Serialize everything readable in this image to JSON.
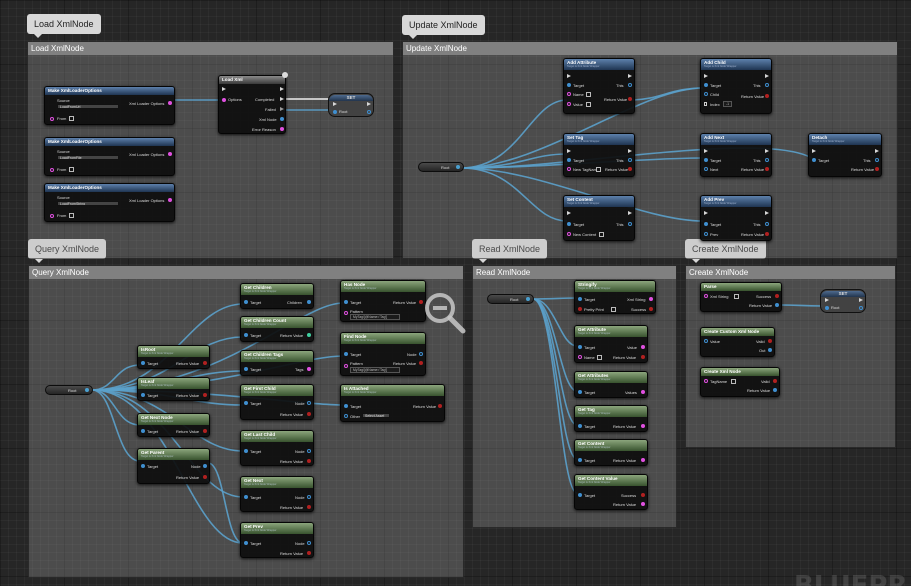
{
  "comments": [
    {
      "title": "Load XmlNode",
      "bubble": "Load XmlNode"
    },
    {
      "title": "Update XmlNode",
      "bubble": "Update XmlNode"
    },
    {
      "title": "Query XmlNode",
      "bubble": "Query XmlNode"
    },
    {
      "title": "Read XmlNode",
      "bubble": "Read XmlNode"
    },
    {
      "title": "Create XmlNode",
      "bubble": "Create XmlNode"
    }
  ],
  "nodes": {
    "make_opts_1": {
      "title": "Make XmlLoaderOptions",
      "source": "Source",
      "source_val": "LoadFromUrl",
      "out": "Xml Loader Options",
      "from": "From"
    },
    "make_opts_2": {
      "title": "Make XmlLoaderOptions",
      "source": "Source",
      "source_val": "LoadFromFile",
      "out": "Xml Loader Options",
      "from": "From"
    },
    "make_opts_3": {
      "title": "Make XmlLoaderOptions",
      "source": "Source",
      "source_val": "LoadFromString",
      "out": "Xml Loader Options",
      "from": "From"
    },
    "load_xml": {
      "title": "Load Xml",
      "options": "Options",
      "completed": "Completed",
      "failed": "Failed",
      "xml_node": "Xml Node",
      "error": "Error Reason"
    },
    "set_load": {
      "title": "SET",
      "pin": "Root"
    },
    "add_attribute": {
      "title": "Add Attribute",
      "sub": "Target is Xml Node Wrapper",
      "target": "Target",
      "this": "This",
      "name": "Name",
      "value": "Value",
      "ret": "Return Value"
    },
    "add_child": {
      "title": "Add Child",
      "sub": "Target is Xml Node Wrapper",
      "target": "Target",
      "this": "This",
      "child": "Child",
      "index": "Index",
      "index_val": "-1",
      "ret": "Return Value"
    },
    "set_tag": {
      "title": "Set Tag",
      "sub": "Target is Xml Node Wrapper",
      "target": "Target",
      "this": "This",
      "new_tag": "New TagName",
      "ret": "Return Value"
    },
    "add_next": {
      "title": "Add Next",
      "sub": "Target is Xml Node Wrapper",
      "target": "Target",
      "this": "This",
      "next": "Next",
      "ret": "Return Value"
    },
    "detach": {
      "title": "Detach",
      "sub": "Target is Xml Node Wrapper",
      "target": "Target",
      "this": "This",
      "ret": "Return Value"
    },
    "set_content": {
      "title": "Set Content",
      "sub": "Target is Xml Node Wrapper",
      "target": "Target",
      "this": "This",
      "new_content": "New Content"
    },
    "add_prev": {
      "title": "Add Prev",
      "sub": "Target is Xml Node Wrapper",
      "target": "Target",
      "this": "This",
      "prev": "Prev",
      "ret": "Return Value"
    },
    "root_update": {
      "label": "Root"
    },
    "root_query": {
      "label": "Root"
    },
    "is_root": {
      "title": "IsRoot",
      "sub": "Target is Xml Node Wrapper",
      "target": "Target",
      "ret": "Return Value"
    },
    "is_leaf": {
      "title": "IsLeaf",
      "sub": "Target is Xml Node Wrapper",
      "target": "Target",
      "ret": "Return Value"
    },
    "get_next_node": {
      "title": "Get Next Node",
      "sub": "Target is Xml Node Wrapper",
      "target": "Target",
      "ret": "Return Value"
    },
    "get_parent": {
      "title": "Get Parent",
      "sub": "Target is Xml Node Wrapper",
      "target": "Target",
      "node": "Node",
      "ret": "Return Value"
    },
    "get_children": {
      "title": "Get Children",
      "sub": "Target is Xml Node Wrapper",
      "target": "Target",
      "children": "Children"
    },
    "get_children_count": {
      "title": "Get Children Count",
      "sub": "Target is Xml Node Wrapper",
      "target": "Target",
      "ret": "Return Value"
    },
    "get_children_tags": {
      "title": "Get Children Tags",
      "sub": "Target is Xml Node Wrapper",
      "target": "Target",
      "tags": "Tags"
    },
    "get_first_child": {
      "title": "Get First Child",
      "sub": "Target is Xml Node Wrapper",
      "target": "Target",
      "node": "Node",
      "ret": "Return Value"
    },
    "get_last_child": {
      "title": "Get Last Child",
      "sub": "Target is Xml Node Wrapper",
      "target": "Target",
      "node": "Node",
      "ret": "Return Value"
    },
    "get_next": {
      "title": "Get Next",
      "sub": "Target is Xml Node Wrapper",
      "target": "Target",
      "node": "Node",
      "ret": "Return Value"
    },
    "get_prev": {
      "title": "Get Prev",
      "sub": "Target is Xml Node Wrapper",
      "target": "Target",
      "node": "Node",
      "ret": "Return Value"
    },
    "has_node": {
      "title": "Has Node",
      "sub": "Target is Xml Node Wrapper",
      "target": "Target",
      "pattern": "Pattern",
      "pattern_val": "MyTag/[@Name='Tag']",
      "ret": "Return Value"
    },
    "find_node": {
      "title": "Find Node",
      "sub": "Target is Xml Node Wrapper",
      "target": "Target",
      "pattern": "Pattern",
      "pattern_val": "MyTag/[@Name='Tag']",
      "node": "Node",
      "ret": "Return Value"
    },
    "is_attached": {
      "title": "Is Attached",
      "sub": "Target is Xml Node Wrapper",
      "target": "Target",
      "other": "Other",
      "other_val": "Select Asset",
      "ret": "Return Value"
    },
    "root_read": {
      "label": "Root"
    },
    "stringify": {
      "title": "Stringify",
      "sub": "Target is Xml Node Wrapper",
      "target": "Target",
      "xml_string": "Xml String",
      "pretty": "Pretty Print",
      "success": "Success"
    },
    "get_attribute": {
      "title": "Get Attribute",
      "sub": "Target is Xml Node Wrapper",
      "target": "Target",
      "name": "Name",
      "value": "Value",
      "ret": "Return Value"
    },
    "get_attributes": {
      "title": "Get Attributes",
      "sub": "Target is Xml Node Wrapper",
      "target": "Target",
      "values": "Values"
    },
    "get_tag": {
      "title": "Get Tag",
      "sub": "Target is Xml Node Wrapper",
      "target": "Target",
      "ret": "Return Value"
    },
    "get_content": {
      "title": "Get Content",
      "sub": "Target is Xml Node Wrapper",
      "target": "Target",
      "ret": "Return Value"
    },
    "get_content_value": {
      "title": "Get Content Value",
      "sub": "Target is Xml Node Wrapper",
      "target": "Target",
      "success": "Success",
      "ret": "Return Value"
    },
    "parse": {
      "title": "Parse",
      "xml_string": "Xml String",
      "success": "Success",
      "ret": "Return Value"
    },
    "set_create": {
      "title": "SET",
      "pin": "Root"
    },
    "create_custom": {
      "title": "Create Custom Xml Node",
      "value": "Value",
      "valid": "Valid",
      "out": "Out"
    },
    "create_xml": {
      "title": "Create Xml Node",
      "tagname": "TagName",
      "valid": "Valid",
      "ret": "Return Value"
    }
  },
  "icons": {
    "zoom": "zoom-out-icon",
    "function": "function-icon"
  },
  "watermark": "BLUEPR",
  "colors": {
    "exec": "#d6d6d6",
    "object_pin": "#3f8fd0",
    "struct_pin": "#e050e0",
    "bool_pin": "#b02020",
    "func_header": "#5d80ab",
    "pure_header": "#8ba57c"
  }
}
